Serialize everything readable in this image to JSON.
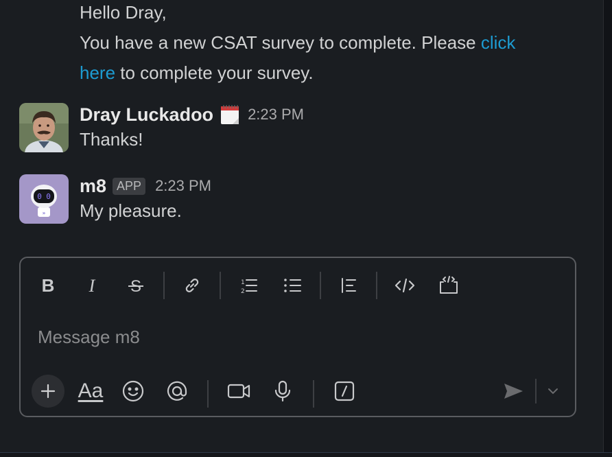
{
  "previous_message": {
    "line1": "Hello Dray,",
    "line2_before_link": "You have a new CSAT survey to complete. Please ",
    "link_text_part1": "click",
    "link_text_part2": "here",
    "line3_after_link": " to complete your survey."
  },
  "messages": [
    {
      "sender": "Dray Luckadoo",
      "time": "2:23 PM",
      "text": "Thanks!",
      "status_emoji": "calendar-icon"
    },
    {
      "sender": "m8",
      "badge": "APP",
      "time": "2:23 PM",
      "text": "My pleasure."
    }
  ],
  "composer": {
    "placeholder": "Message m8",
    "toolbar": [
      "bold",
      "italic",
      "strikethrough",
      "link",
      "ordered-list",
      "bulleted-list",
      "blockquote",
      "code",
      "code-block"
    ],
    "format_label": "Aa",
    "bottom_actions": [
      "add",
      "formatting",
      "emoji",
      "mention",
      "video",
      "audio",
      "shortcuts",
      "send",
      "send-options"
    ]
  },
  "colors": {
    "background": "#1a1d21",
    "link": "#1d9bd1",
    "border": "#5a5c60"
  }
}
